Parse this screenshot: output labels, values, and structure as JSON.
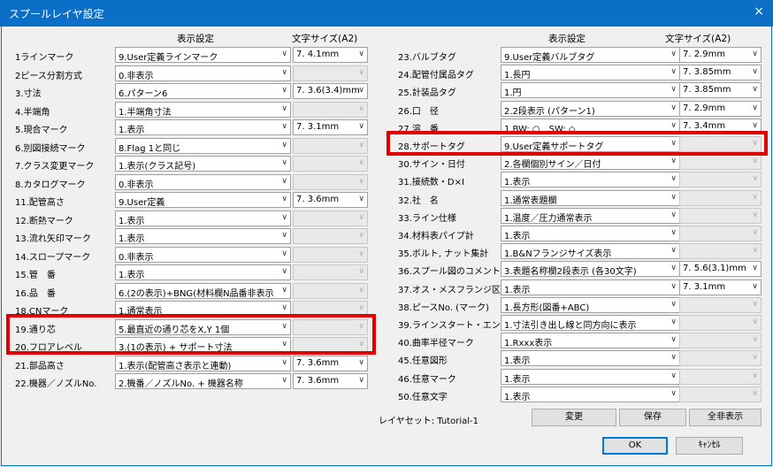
{
  "window": {
    "title": "スプールレイヤ設定",
    "close_glyph": "×"
  },
  "headers": {
    "left_display": "表示設定",
    "left_size": "文字サイズ(A2)",
    "right_display": "表示設定",
    "right_size": "文字サイズ(A2)"
  },
  "left_rows": [
    {
      "label": "1ラインマーク",
      "value": "9.User定義ラインマーク",
      "size": "7. 4.1mm"
    },
    {
      "label": "2ピース分割方式",
      "value": "0.非表示",
      "size": ""
    },
    {
      "label": "3.寸法",
      "value": "6.パターン6",
      "size": "7. 3.6(3.4)mm"
    },
    {
      "label": "4.半端角",
      "value": "1.半端角寸法",
      "size": ""
    },
    {
      "label": "5.現合マーク",
      "value": "1.表示",
      "size": "7. 3.1mm"
    },
    {
      "label": "6.別図接続マーク",
      "value": "8.Flag 1と同じ",
      "size": ""
    },
    {
      "label": "7.クラス変更マーク",
      "value": "1.表示(クラス記号)",
      "size": ""
    },
    {
      "label": "8.カタログマーク",
      "value": "0.非表示",
      "size": ""
    },
    {
      "label": "11.配管高さ",
      "value": "9.User定義",
      "size": "7. 3.6mm"
    },
    {
      "label": "12.断熱マーク",
      "value": "1.表示",
      "size": ""
    },
    {
      "label": "13.流れ矢印マーク",
      "value": "1.表示",
      "size": ""
    },
    {
      "label": "14.スロープマーク",
      "value": "0.非表示",
      "size": ""
    },
    {
      "label": "15.管　番",
      "value": "1.表示",
      "size": ""
    },
    {
      "label": "16.品　番",
      "value": "6.(2の表示)+BNG(材料欄N品番非表示",
      "size": ""
    },
    {
      "label": "18.CNマーク",
      "value": "1.通常表示",
      "size": ""
    },
    {
      "label": "19.通り芯",
      "value": "5.最直近の通り芯をX,Y 1個",
      "size": ""
    },
    {
      "label": "20.フロアレベル",
      "value": "3.(1の表示) + サポート寸法",
      "size": ""
    },
    {
      "label": "21.部品高さ",
      "value": "1.表示(配管高さ表示と連動)",
      "size": "7. 3.6mm"
    },
    {
      "label": "22.機器／ノズルNo.",
      "value": "2.機番／ノズルNo. + 機器名称",
      "size": "7. 3.6mm"
    }
  ],
  "right_rows": [
    {
      "label": "23.バルブタグ",
      "value": "9.User定義バルブタグ",
      "size": "7. 2.9mm"
    },
    {
      "label": "24.配管付属品タグ",
      "value": "1.長円",
      "size": "7. 3.85mm"
    },
    {
      "label": "25.計装品タグ",
      "value": "1.円",
      "size": "7. 3.85mm"
    },
    {
      "label": "26.口　径",
      "value": "2.2段表示 (パターン1)",
      "size": "7. 2.9mm"
    },
    {
      "label": "27.溶　番",
      "value": "1.BW: ○　SW: ◇",
      "size": "7. 3.4mm"
    },
    {
      "label": "28.サポートタグ",
      "value": "9.User定義サポートタグ",
      "size": ""
    },
    {
      "label": "30.サイン・日付",
      "value": "2.各欄個別サイン／日付",
      "size": ""
    },
    {
      "label": "31.接続数・D×I",
      "value": "1.表示",
      "size": ""
    },
    {
      "label": "32.社　名",
      "value": "1.通常表題欄",
      "size": ""
    },
    {
      "label": "33.ライン仕様",
      "value": "1.温度／圧力通常表示",
      "size": ""
    },
    {
      "label": "34.材料表パイプ計",
      "value": "1.表示",
      "size": ""
    },
    {
      "label": "35.ボルト, ナット集計",
      "value": "1.B&Nフランジサイズ表示",
      "size": ""
    },
    {
      "label": "36.スプール図のコメント",
      "value": "3.表題名称欄2段表示 (各30文字)",
      "size": "7. 5.6(3.1)mm"
    },
    {
      "label": "37.オス・メスフランジ区分",
      "value": "1.表示",
      "size": "7. 3.1mm"
    },
    {
      "label": "38.ピースNo. (マーク)",
      "value": "1.長方形(図番+ABC)",
      "size": ""
    },
    {
      "label": "39.ラインスタート・エンド",
      "value": "1.寸法引き出し線と同方向に表示",
      "size": ""
    },
    {
      "label": "40.曲率半径マーク",
      "value": "1.Rxxx表示",
      "size": ""
    },
    {
      "label": "45.任意図形",
      "value": "1.表示",
      "size": ""
    },
    {
      "label": "46.任意マーク",
      "value": "1.表示",
      "size": ""
    },
    {
      "label": "50.任意文字",
      "value": "1.表示",
      "size": ""
    }
  ],
  "footer": {
    "layer_set": "レイヤセット:  Tutorial-1",
    "change": "変更",
    "save": "保存",
    "hide_all": "全非表示",
    "ok": "OK",
    "cancel": "ｷｬﾝｾﾙ"
  },
  "colors": {
    "titlebar": "#0b6fc8",
    "highlight": "#e00000"
  }
}
